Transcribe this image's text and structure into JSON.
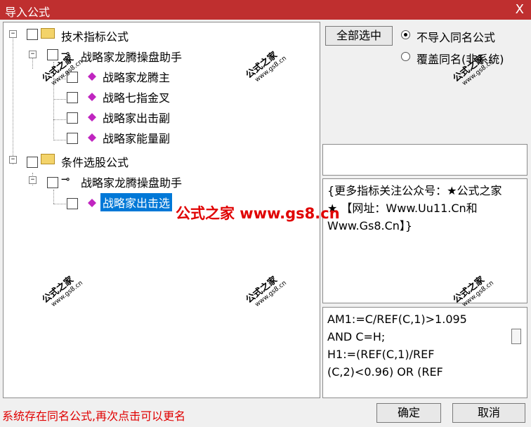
{
  "window": {
    "title": "导入公式",
    "close_glyph": "X"
  },
  "tree": {
    "group1": {
      "label": "技术指标公式",
      "child": {
        "label": "战略家龙腾操盘助手",
        "items": [
          "战略家龙腾主",
          "战略七指金叉",
          "战略家出击副",
          "战略家能量副"
        ]
      }
    },
    "group2": {
      "label": "条件选股公式",
      "child": {
        "label": "战略家龙腾操盘助手",
        "items": [
          "战略家出击选"
        ]
      }
    },
    "selected_item": "战略家出击选"
  },
  "right": {
    "select_all_label": "全部选中",
    "radio1_label": "不导入同名公式",
    "radio2_label": "覆盖同名(非系统)",
    "description": "{更多指标关注公众号：★公式之家★ 【网址：Www.Uu11.Cn和Www.Gs8.Cn】}",
    "code": "AM1:=C/REF(C,1)>1.095\nAND C=H;\nH1:=(REF(C,1)/REF\n(C,2)<0.96) OR (REF"
  },
  "footer": {
    "status": "系统存在同名公式,再次点击可以更名",
    "ok_label": "确定",
    "cancel_label": "取消"
  },
  "watermark": {
    "brand": "公式之家",
    "site": "www.gs8.cn",
    "center": "公式之家 www.gs8.cn"
  }
}
